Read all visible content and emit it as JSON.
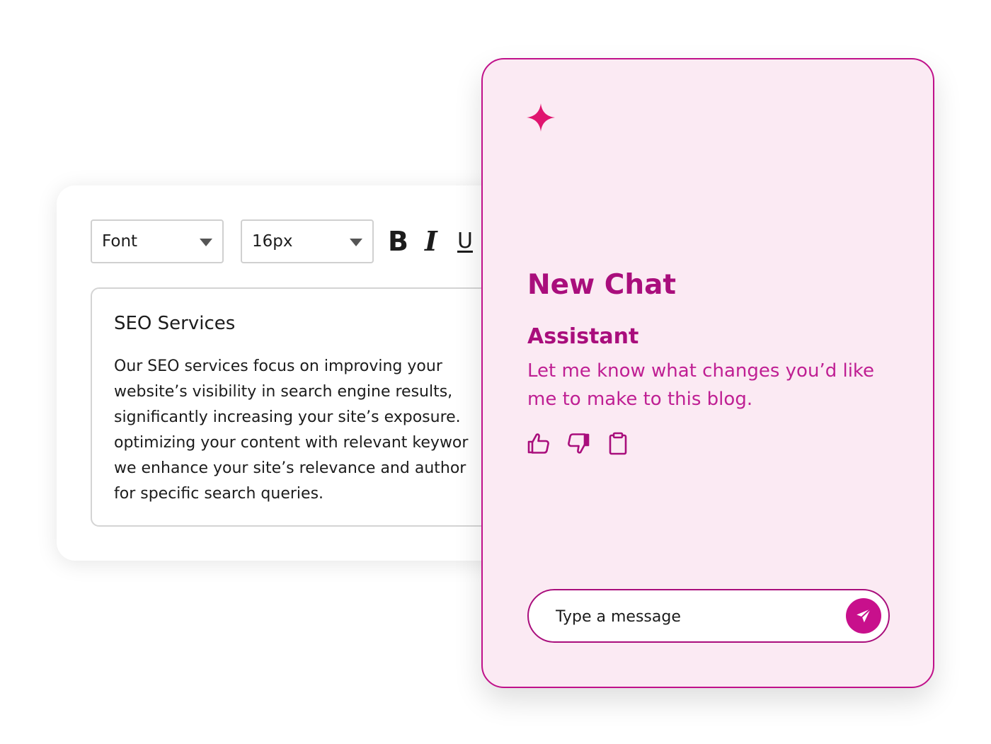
{
  "editor": {
    "font_select": {
      "value": "Font"
    },
    "size_select": {
      "value": "16px"
    },
    "format": {
      "bold": "B",
      "italic": "I",
      "underline": "U"
    },
    "document": {
      "title": "SEO Services",
      "lines": [
        "Our SEO services focus on improving your",
        "website’s visibility in search engine results,",
        "significantly increasing your site’s exposure.",
        "optimizing your content with relevant keywor",
        "we enhance your site’s relevance and author",
        "for specific search queries."
      ]
    }
  },
  "chat": {
    "title": "New Chat",
    "role": "Assistant",
    "message_lines": [
      "Let me know what changes you’d like",
      "me to make to this blog."
    ],
    "actions": [
      "thumbs-up-icon",
      "thumbs-down-icon",
      "clipboard-icon"
    ],
    "input": {
      "placeholder": "Type a message",
      "value": ""
    },
    "colors": {
      "accent": "#c0118a",
      "panel_bg": "#fbeaf3",
      "heading": "#a90e7c",
      "message": "#bf1f93",
      "sparkle": "#e0156f"
    }
  }
}
